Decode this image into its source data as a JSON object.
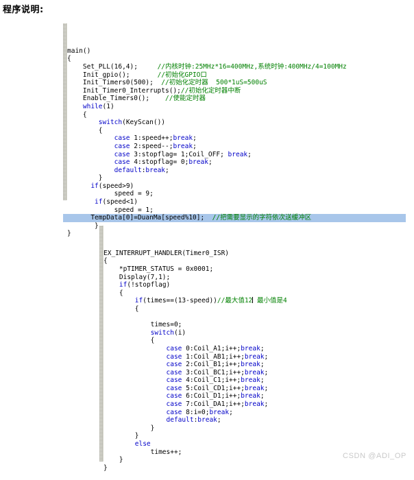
{
  "document": {
    "title": "程序说明:"
  },
  "watermark": {
    "text": "CSDN @ADI_OP"
  },
  "colors": {
    "keyword": "#0000c8",
    "comment": "#008000",
    "text": "#000000",
    "selection": "#a8c6ea",
    "gutter": "#ebebe3",
    "watermark": "#c9c9c9",
    "background": "#ffffff"
  },
  "code_block_main": {
    "name": "main-function-listing",
    "lines": [
      {
        "indent": 0,
        "parts": [
          {
            "t": "main()",
            "c": "txt"
          }
        ]
      },
      {
        "indent": 0,
        "parts": [
          {
            "t": "{",
            "c": "txt"
          }
        ]
      },
      {
        "indent": 4,
        "parts": [
          {
            "t": "Set_PLL(16,4);     ",
            "c": "txt"
          },
          {
            "t": "//内核时钟:25MHz*16=400MHz,系统时钟:400MHz/4=100MHz",
            "c": "cmt"
          }
        ]
      },
      {
        "indent": 4,
        "parts": [
          {
            "t": "Init_gpio();       ",
            "c": "txt"
          },
          {
            "t": "//初始化GPIO口",
            "c": "cmt"
          }
        ]
      },
      {
        "indent": 4,
        "parts": [
          {
            "t": "Init_Timers0(500);  ",
            "c": "txt"
          },
          {
            "t": "//初始化定时器  500*1uS=500uS",
            "c": "cmt"
          }
        ]
      },
      {
        "indent": 4,
        "parts": [
          {
            "t": "Init_Timer0_Interrupts();",
            "c": "txt"
          },
          {
            "t": "//初始化定时器中断",
            "c": "cmt"
          }
        ]
      },
      {
        "indent": 4,
        "parts": [
          {
            "t": "Enable_Timers0();    ",
            "c": "txt"
          },
          {
            "t": "//使能定时器",
            "c": "cmt"
          }
        ]
      },
      {
        "indent": 4,
        "parts": [
          {
            "t": "while",
            "c": "kw"
          },
          {
            "t": "(1)",
            "c": "txt"
          }
        ]
      },
      {
        "indent": 4,
        "parts": [
          {
            "t": "{",
            "c": "txt"
          }
        ]
      },
      {
        "indent": 8,
        "parts": [
          {
            "t": "switch",
            "c": "kw"
          },
          {
            "t": "(KeyScan())",
            "c": "txt"
          }
        ]
      },
      {
        "indent": 8,
        "parts": [
          {
            "t": "{",
            "c": "txt"
          }
        ]
      },
      {
        "indent": 12,
        "parts": [
          {
            "t": "case",
            "c": "kw"
          },
          {
            "t": " 1:speed++;",
            "c": "txt"
          },
          {
            "t": "break",
            "c": "kw"
          },
          {
            "t": ";",
            "c": "txt"
          }
        ]
      },
      {
        "indent": 12,
        "parts": [
          {
            "t": "case",
            "c": "kw"
          },
          {
            "t": " 2:speed--;",
            "c": "txt"
          },
          {
            "t": "break",
            "c": "kw"
          },
          {
            "t": ";",
            "c": "txt"
          }
        ]
      },
      {
        "indent": 12,
        "parts": [
          {
            "t": "case",
            "c": "kw"
          },
          {
            "t": " 3:stopflag= 1;Coil_OFF; ",
            "c": "txt"
          },
          {
            "t": "break",
            "c": "kw"
          },
          {
            "t": ";",
            "c": "txt"
          }
        ]
      },
      {
        "indent": 12,
        "parts": [
          {
            "t": "case",
            "c": "kw"
          },
          {
            "t": " 4:stopflag= 0;",
            "c": "txt"
          },
          {
            "t": "break",
            "c": "kw"
          },
          {
            "t": ";",
            "c": "txt"
          }
        ]
      },
      {
        "indent": 12,
        "parts": [
          {
            "t": "default",
            "c": "kw"
          },
          {
            "t": ":",
            "c": "txt"
          },
          {
            "t": "break",
            "c": "kw"
          },
          {
            "t": ";",
            "c": "txt"
          }
        ]
      },
      {
        "indent": 8,
        "parts": [
          {
            "t": "}",
            "c": "txt"
          }
        ]
      },
      {
        "indent": 6,
        "parts": [
          {
            "t": "if",
            "c": "kw"
          },
          {
            "t": "(speed>9)",
            "c": "txt"
          }
        ]
      },
      {
        "indent": 12,
        "parts": [
          {
            "t": "speed = 9;",
            "c": "txt"
          }
        ]
      },
      {
        "indent": 7,
        "parts": [
          {
            "t": "if",
            "c": "kw"
          },
          {
            "t": "(speed<1)",
            "c": "txt"
          }
        ]
      },
      {
        "indent": 12,
        "parts": [
          {
            "t": "speed = 1;",
            "c": "txt"
          }
        ]
      },
      {
        "indent": 6,
        "selected": true,
        "parts": [
          {
            "t": "TempData[0]=DuanMa[speed%10];  ",
            "c": "txt"
          },
          {
            "t": "//把需要显示的字符依次送缓冲区",
            "c": "cmt"
          }
        ]
      },
      {
        "indent": 7,
        "parts": [
          {
            "t": "}",
            "c": "txt"
          }
        ]
      },
      {
        "indent": 0,
        "parts": [
          {
            "t": "}",
            "c": "txt"
          }
        ]
      }
    ]
  },
  "code_block_isr": {
    "name": "timer0-isr-listing",
    "lines": [
      {
        "indent": 0,
        "parts": [
          {
            "t": "EX_INTERRUPT_HANDLER(Timer0_ISR)",
            "c": "txt"
          }
        ]
      },
      {
        "indent": 0,
        "parts": [
          {
            "t": "{",
            "c": "txt"
          }
        ]
      },
      {
        "indent": 4,
        "parts": [
          {
            "t": "*pTIMER_STATUS = 0x0001;",
            "c": "txt"
          }
        ]
      },
      {
        "indent": 4,
        "parts": [
          {
            "t": "Display(7,1);",
            "c": "txt"
          }
        ]
      },
      {
        "indent": 4,
        "parts": [
          {
            "t": "if",
            "c": "kw"
          },
          {
            "t": "(!stopflag)",
            "c": "txt"
          }
        ]
      },
      {
        "indent": 4,
        "parts": [
          {
            "t": "{",
            "c": "txt"
          }
        ]
      },
      {
        "indent": 8,
        "caret_after": "//最大值12",
        "parts": [
          {
            "t": "if",
            "c": "kw"
          },
          {
            "t": "(times==(13-speed))",
            "c": "txt"
          },
          {
            "t": "//最大值12",
            "c": "cmt"
          },
          {
            "t": "CARET",
            "c": "caret"
          },
          {
            "t": " 最小值是4",
            "c": "cmt"
          }
        ]
      },
      {
        "indent": 8,
        "parts": [
          {
            "t": "{",
            "c": "txt"
          }
        ]
      },
      {
        "indent": 0,
        "parts": [
          {
            "t": "",
            "c": "txt"
          }
        ]
      },
      {
        "indent": 12,
        "parts": [
          {
            "t": "times=0;",
            "c": "txt"
          }
        ]
      },
      {
        "indent": 12,
        "parts": [
          {
            "t": "switch",
            "c": "kw"
          },
          {
            "t": "(i)",
            "c": "txt"
          }
        ]
      },
      {
        "indent": 12,
        "parts": [
          {
            "t": "{",
            "c": "txt"
          }
        ]
      },
      {
        "indent": 16,
        "parts": [
          {
            "t": "case",
            "c": "kw"
          },
          {
            "t": " 0:Coil_A1;i++;",
            "c": "txt"
          },
          {
            "t": "break",
            "c": "kw"
          },
          {
            "t": ";",
            "c": "txt"
          }
        ]
      },
      {
        "indent": 16,
        "parts": [
          {
            "t": "case",
            "c": "kw"
          },
          {
            "t": " 1:Coil_AB1;i++;",
            "c": "txt"
          },
          {
            "t": "break",
            "c": "kw"
          },
          {
            "t": ";",
            "c": "txt"
          }
        ]
      },
      {
        "indent": 16,
        "parts": [
          {
            "t": "case",
            "c": "kw"
          },
          {
            "t": " 2:Coil_B1;i++;",
            "c": "txt"
          },
          {
            "t": "break",
            "c": "kw"
          },
          {
            "t": ";",
            "c": "txt"
          }
        ]
      },
      {
        "indent": 16,
        "parts": [
          {
            "t": "case",
            "c": "kw"
          },
          {
            "t": " 3:Coil_BC1;i++;",
            "c": "txt"
          },
          {
            "t": "break",
            "c": "kw"
          },
          {
            "t": ";",
            "c": "txt"
          }
        ]
      },
      {
        "indent": 16,
        "parts": [
          {
            "t": "case",
            "c": "kw"
          },
          {
            "t": " 4:Coil_C1;i++;",
            "c": "txt"
          },
          {
            "t": "break",
            "c": "kw"
          },
          {
            "t": ";",
            "c": "txt"
          }
        ]
      },
      {
        "indent": 16,
        "parts": [
          {
            "t": "case",
            "c": "kw"
          },
          {
            "t": " 5:Coil_CD1;i++;",
            "c": "txt"
          },
          {
            "t": "break",
            "c": "kw"
          },
          {
            "t": ";",
            "c": "txt"
          }
        ]
      },
      {
        "indent": 16,
        "parts": [
          {
            "t": "case",
            "c": "kw"
          },
          {
            "t": " 6:Coil_D1;i++;",
            "c": "txt"
          },
          {
            "t": "break",
            "c": "kw"
          },
          {
            "t": ";",
            "c": "txt"
          }
        ]
      },
      {
        "indent": 16,
        "parts": [
          {
            "t": "case",
            "c": "kw"
          },
          {
            "t": " 7:Coil_DA1;i++;",
            "c": "txt"
          },
          {
            "t": "break",
            "c": "kw"
          },
          {
            "t": ";",
            "c": "txt"
          }
        ]
      },
      {
        "indent": 16,
        "parts": [
          {
            "t": "case",
            "c": "kw"
          },
          {
            "t": " 8:i=0;",
            "c": "txt"
          },
          {
            "t": "break",
            "c": "kw"
          },
          {
            "t": ";",
            "c": "txt"
          }
        ]
      },
      {
        "indent": 16,
        "parts": [
          {
            "t": "default",
            "c": "kw"
          },
          {
            "t": ":",
            "c": "txt"
          },
          {
            "t": "break",
            "c": "kw"
          },
          {
            "t": ";",
            "c": "txt"
          }
        ]
      },
      {
        "indent": 12,
        "parts": [
          {
            "t": "}",
            "c": "txt"
          }
        ]
      },
      {
        "indent": 8,
        "parts": [
          {
            "t": "}",
            "c": "txt"
          }
        ]
      },
      {
        "indent": 8,
        "parts": [
          {
            "t": "else",
            "c": "kw"
          }
        ]
      },
      {
        "indent": 12,
        "parts": [
          {
            "t": "times++;",
            "c": "txt"
          }
        ]
      },
      {
        "indent": 4,
        "parts": [
          {
            "t": "}",
            "c": "txt"
          }
        ]
      },
      {
        "indent": 0,
        "parts": [
          {
            "t": "}",
            "c": "txt"
          }
        ]
      }
    ]
  }
}
